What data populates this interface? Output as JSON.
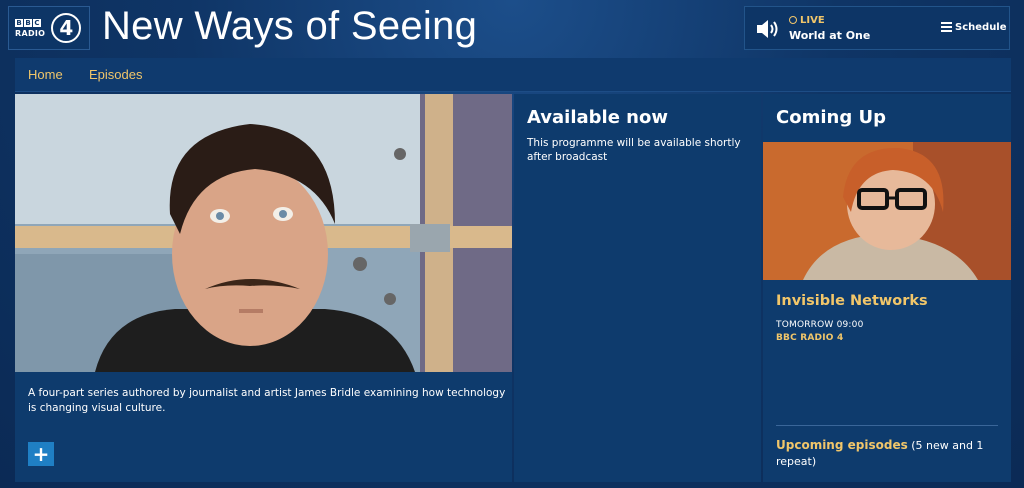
{
  "brand": {
    "bbc_letters": [
      "B",
      "B",
      "C"
    ],
    "radio_label": "RADIO",
    "station_number": "4"
  },
  "page_title": "New Ways of Seeing",
  "live": {
    "label": "LIVE",
    "programme": "World at One",
    "schedule_label": "Schedule"
  },
  "nav": {
    "items": [
      {
        "label": "Home"
      },
      {
        "label": "Episodes"
      }
    ]
  },
  "main": {
    "description": "A four-part series authored by journalist and artist James Bridle examining how technology is changing visual culture.",
    "expand_label": "+"
  },
  "available": {
    "heading": "Available now",
    "text": "This programme will be available shortly after broadcast"
  },
  "coming_up": {
    "heading": "Coming Up",
    "episode_title": "Invisible Networks",
    "time": "TOMORROW 09:00",
    "station": "BBC RADIO 4",
    "upcoming_link": "Upcoming episodes",
    "upcoming_detail": " (5 new and 1 repeat)"
  },
  "colors": {
    "accent_yellow": "#f1c66a",
    "panel_blue": "#0e3b6d",
    "button_blue": "#1f7fc4"
  },
  "icons": [
    "speaker-icon",
    "live-indicator-icon",
    "schedule-icon",
    "plus-icon"
  ]
}
